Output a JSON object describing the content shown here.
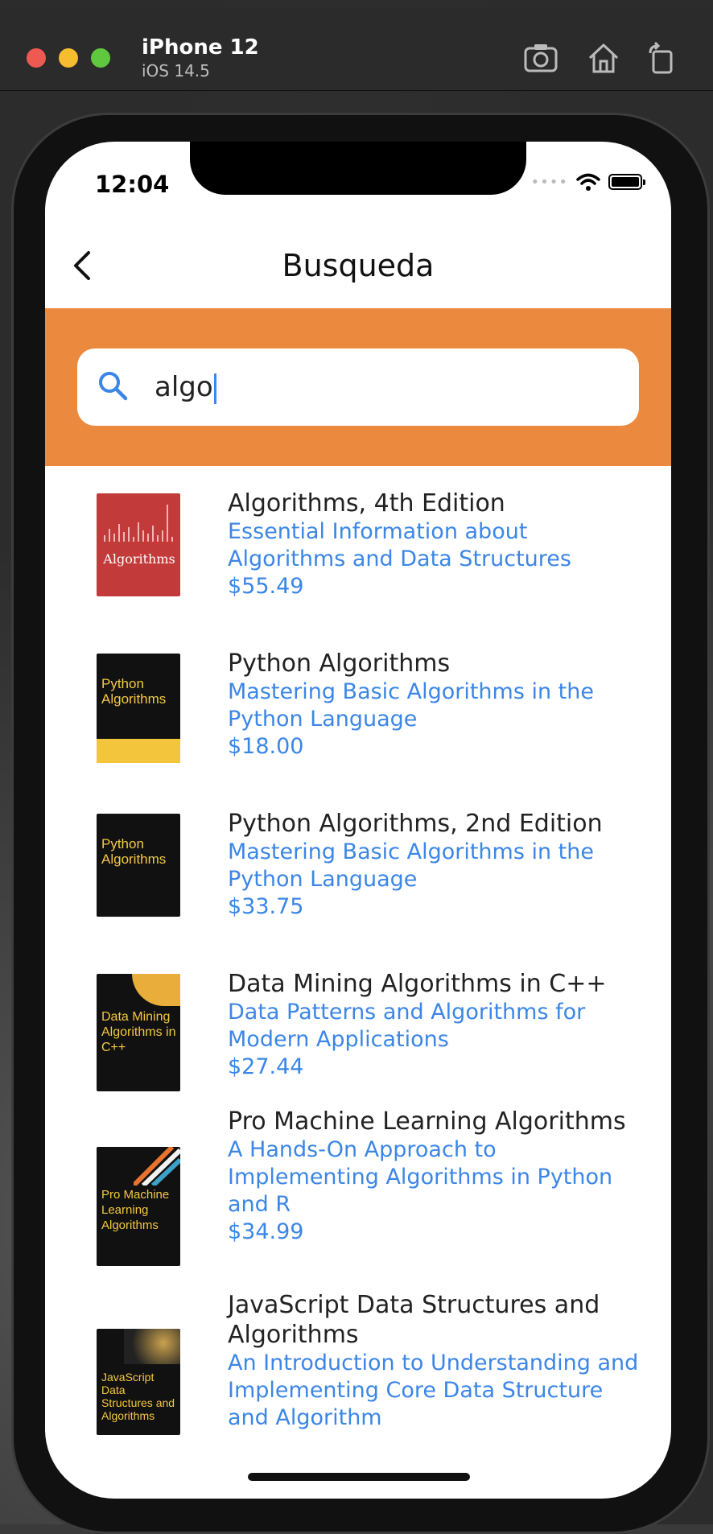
{
  "simulator": {
    "device_name": "iPhone 12",
    "os_version": "iOS 14.5",
    "buttons": [
      "screenshot-icon",
      "home-icon",
      "rotate-icon"
    ]
  },
  "status_bar": {
    "time": "12:04"
  },
  "nav": {
    "title": "Busqueda"
  },
  "search": {
    "value": "algo",
    "accent": "#eb8a3e"
  },
  "books": [
    {
      "title": "Algorithms, 4th Edition",
      "subtitle": "Essential Information about Algorithms and Data Structures",
      "price": "$55.49",
      "cover_text": "Algorithms"
    },
    {
      "title": "Python Algorithms",
      "subtitle": "Mastering Basic Algorithms in the Python Language",
      "price": "$18.00",
      "cover_text": "Python Algorithms"
    },
    {
      "title": "Python Algorithms, 2nd Edition",
      "subtitle": "Mastering Basic Algorithms in the Python Language",
      "price": "$33.75",
      "cover_text": "Python Algorithms"
    },
    {
      "title": "Data Mining Algorithms in C++",
      "subtitle": "Data Patterns and Algorithms for Modern Applications",
      "price": "$27.44",
      "cover_text": "Data Mining Algorithms in C++"
    },
    {
      "title": "Pro Machine Learning Algorithms",
      "subtitle": "A Hands-On Approach to Implementing Algorithms in Python and R",
      "price": "$34.99",
      "cover_text": "Pro Machine Learning Algorithms"
    },
    {
      "title": "JavaScript Data Structures and Algorithms",
      "subtitle": "An Introduction to Understanding and Implementing Core Data Structure and Algorithm",
      "price": "",
      "cover_text": "JavaScript Data Structures and Algorithms"
    }
  ],
  "colors": {
    "link_blue": "#3b86e6",
    "orange": "#eb8a3e"
  }
}
